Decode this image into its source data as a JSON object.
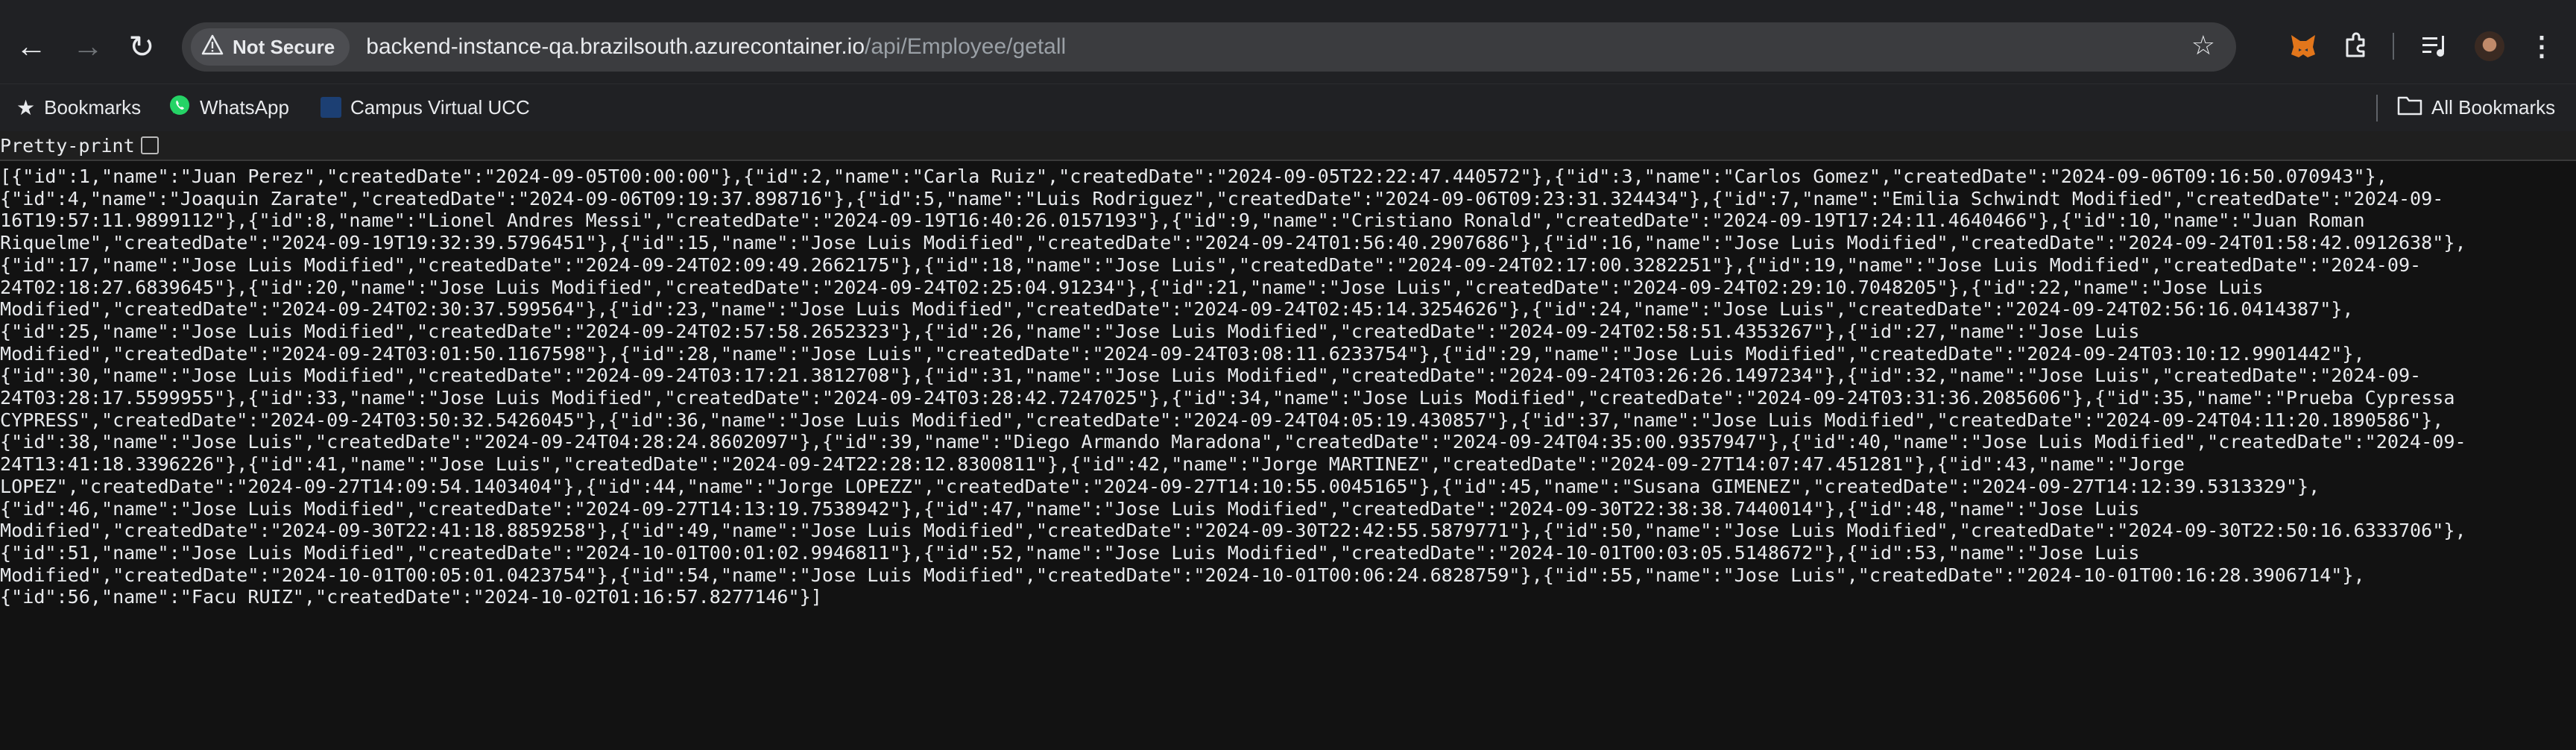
{
  "browser": {
    "security_label": "Not Secure",
    "url_host": "backend-instance-qa.brazilsouth.azurecontainer.io",
    "url_path": "/api/Employee/getall"
  },
  "bookmarks": {
    "folder": "Bookmarks",
    "items": [
      "WhatsApp",
      "Campus Virtual UCC"
    ],
    "all": "All Bookmarks"
  },
  "pretty_print_label": "Pretty-print",
  "json_lines": [
    "[{\"id\":1,\"name\":\"Juan Perez\",\"createdDate\":\"2024-09-05T00:00:00\"},{\"id\":2,\"name\":\"Carla Ruiz\",\"createdDate\":\"2024-09-05T22:22:47.440572\"},{\"id\":3,\"name\":\"Carlos Gomez\",\"createdDate\":\"2024-09-06T09:16:50.070943\"},",
    "{\"id\":4,\"name\":\"Joaquin Zarate\",\"createdDate\":\"2024-09-06T09:19:37.898716\"},{\"id\":5,\"name\":\"Luis Rodriguez\",\"createdDate\":\"2024-09-06T09:23:31.324434\"},{\"id\":7,\"name\":\"Emilia Schwindt Modified\",\"createdDate\":\"2024-09-",
    "16T19:57:11.9899112\"},{\"id\":8,\"name\":\"Lionel Andres Messi\",\"createdDate\":\"2024-09-19T16:40:26.0157193\"},{\"id\":9,\"name\":\"Cristiano Ronald\",\"createdDate\":\"2024-09-19T17:24:11.4640466\"},{\"id\":10,\"name\":\"Juan Roman",
    "Riquelme\",\"createdDate\":\"2024-09-19T19:32:39.5796451\"},{\"id\":15,\"name\":\"Jose Luis Modified\",\"createdDate\":\"2024-09-24T01:56:40.2907686\"},{\"id\":16,\"name\":\"Jose Luis Modified\",\"createdDate\":\"2024-09-24T01:58:42.0912638\"},",
    "{\"id\":17,\"name\":\"Jose Luis Modified\",\"createdDate\":\"2024-09-24T02:09:49.2662175\"},{\"id\":18,\"name\":\"Jose Luis\",\"createdDate\":\"2024-09-24T02:17:00.3282251\"},{\"id\":19,\"name\":\"Jose Luis Modified\",\"createdDate\":\"2024-09-",
    "24T02:18:27.6839645\"},{\"id\":20,\"name\":\"Jose Luis Modified\",\"createdDate\":\"2024-09-24T02:25:04.91234\"},{\"id\":21,\"name\":\"Jose Luis\",\"createdDate\":\"2024-09-24T02:29:10.7048205\"},{\"id\":22,\"name\":\"Jose Luis",
    "Modified\",\"createdDate\":\"2024-09-24T02:30:37.599564\"},{\"id\":23,\"name\":\"Jose Luis Modified\",\"createdDate\":\"2024-09-24T02:45:14.3254626\"},{\"id\":24,\"name\":\"Jose Luis\",\"createdDate\":\"2024-09-24T02:56:16.0414387\"},",
    "{\"id\":25,\"name\":\"Jose Luis Modified\",\"createdDate\":\"2024-09-24T02:57:58.2652323\"},{\"id\":26,\"name\":\"Jose Luis Modified\",\"createdDate\":\"2024-09-24T02:58:51.4353267\"},{\"id\":27,\"name\":\"Jose Luis",
    "Modified\",\"createdDate\":\"2024-09-24T03:01:50.1167598\"},{\"id\":28,\"name\":\"Jose Luis\",\"createdDate\":\"2024-09-24T03:08:11.6233754\"},{\"id\":29,\"name\":\"Jose Luis Modified\",\"createdDate\":\"2024-09-24T03:10:12.9901442\"},",
    "{\"id\":30,\"name\":\"Jose Luis Modified\",\"createdDate\":\"2024-09-24T03:17:21.3812708\"},{\"id\":31,\"name\":\"Jose Luis Modified\",\"createdDate\":\"2024-09-24T03:26:26.1497234\"},{\"id\":32,\"name\":\"Jose Luis\",\"createdDate\":\"2024-09-",
    "24T03:28:17.5599955\"},{\"id\":33,\"name\":\"Jose Luis Modified\",\"createdDate\":\"2024-09-24T03:28:42.7247025\"},{\"id\":34,\"name\":\"Jose Luis Modified\",\"createdDate\":\"2024-09-24T03:31:36.2085606\"},{\"id\":35,\"name\":\"Prueba Cypressa",
    "CYPRESS\",\"createdDate\":\"2024-09-24T03:50:32.5426045\"},{\"id\":36,\"name\":\"Jose Luis Modified\",\"createdDate\":\"2024-09-24T04:05:19.430857\"},{\"id\":37,\"name\":\"Jose Luis Modified\",\"createdDate\":\"2024-09-24T04:11:20.1890586\"},",
    "{\"id\":38,\"name\":\"Jose Luis\",\"createdDate\":\"2024-09-24T04:28:24.8602097\"},{\"id\":39,\"name\":\"Diego Armando Maradona\",\"createdDate\":\"2024-09-24T04:35:00.9357947\"},{\"id\":40,\"name\":\"Jose Luis Modified\",\"createdDate\":\"2024-09-",
    "24T13:41:18.3396226\"},{\"id\":41,\"name\":\"Jose Luis\",\"createdDate\":\"2024-09-24T22:28:12.8300811\"},{\"id\":42,\"name\":\"Jorge MARTINEZ\",\"createdDate\":\"2024-09-27T14:07:47.451281\"},{\"id\":43,\"name\":\"Jorge",
    "LOPEZ\",\"createdDate\":\"2024-09-27T14:09:54.1403404\"},{\"id\":44,\"name\":\"Jorge LOPEZZ\",\"createdDate\":\"2024-09-27T14:10:55.0045165\"},{\"id\":45,\"name\":\"Susana GIMENEZ\",\"createdDate\":\"2024-09-27T14:12:39.5313329\"},",
    "{\"id\":46,\"name\":\"Jose Luis Modified\",\"createdDate\":\"2024-09-27T14:13:19.7538942\"},{\"id\":47,\"name\":\"Jose Luis Modified\",\"createdDate\":\"2024-09-30T22:38:38.7440014\"},{\"id\":48,\"name\":\"Jose Luis",
    "Modified\",\"createdDate\":\"2024-09-30T22:41:18.8859258\"},{\"id\":49,\"name\":\"Jose Luis Modified\",\"createdDate\":\"2024-09-30T22:42:55.5879771\"},{\"id\":50,\"name\":\"Jose Luis Modified\",\"createdDate\":\"2024-09-30T22:50:16.6333706\"},",
    "{\"id\":51,\"name\":\"Jose Luis Modified\",\"createdDate\":\"2024-10-01T00:01:02.9946811\"},{\"id\":52,\"name\":\"Jose Luis Modified\",\"createdDate\":\"2024-10-01T00:03:05.5148672\"},{\"id\":53,\"name\":\"Jose Luis",
    "Modified\",\"createdDate\":\"2024-10-01T00:05:01.0423754\"},{\"id\":54,\"name\":\"Jose Luis Modified\",\"createdDate\":\"2024-10-01T00:06:24.6828759\"},{\"id\":55,\"name\":\"Jose Luis\",\"createdDate\":\"2024-10-01T00:16:28.3906714\"},",
    "{\"id\":56,\"name\":\"Facu RUIZ\",\"createdDate\":\"2024-10-02T01:16:57.8277146\"}]"
  ]
}
